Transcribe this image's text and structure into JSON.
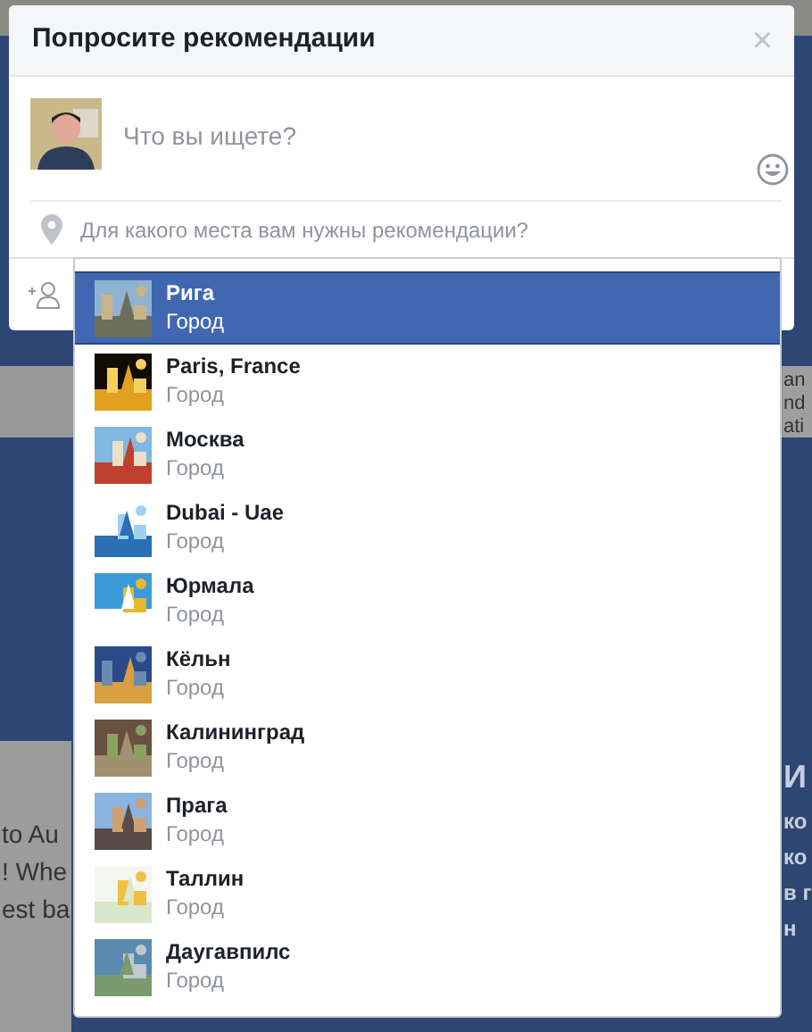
{
  "background": {
    "left_card": {
      "lines": [
        "to Au",
        "! Whe",
        "est ba"
      ]
    },
    "right_card": {
      "lines": [
        "an",
        "nd",
        "ati"
      ]
    },
    "right_banner": {
      "lines": [
        "И",
        "ко",
        "ко",
        "в г",
        "н"
      ]
    }
  },
  "dialog": {
    "title": "Попросите рекомендации",
    "close": "×",
    "post_placeholder": "Что вы ищете?",
    "place_placeholder": "Для какого места вам нужны рекомендации?"
  },
  "suggestions": [
    {
      "name": "Рига",
      "type": "Город",
      "selected": true
    },
    {
      "name": "Paris, France",
      "type": "Город",
      "selected": false
    },
    {
      "name": "Москва",
      "type": "Город",
      "selected": false
    },
    {
      "name": "Dubai - Uae",
      "type": "Город",
      "selected": false
    },
    {
      "name": "Юрмала",
      "type": "Город",
      "selected": false
    },
    {
      "name": "Кёльн",
      "type": "Город",
      "selected": false
    },
    {
      "name": "Калининград",
      "type": "Город",
      "selected": false
    },
    {
      "name": "Прага",
      "type": "Город",
      "selected": false
    },
    {
      "name": "Таллин",
      "type": "Город",
      "selected": false
    },
    {
      "name": "Даугавпилс",
      "type": "Город",
      "selected": false
    }
  ]
}
